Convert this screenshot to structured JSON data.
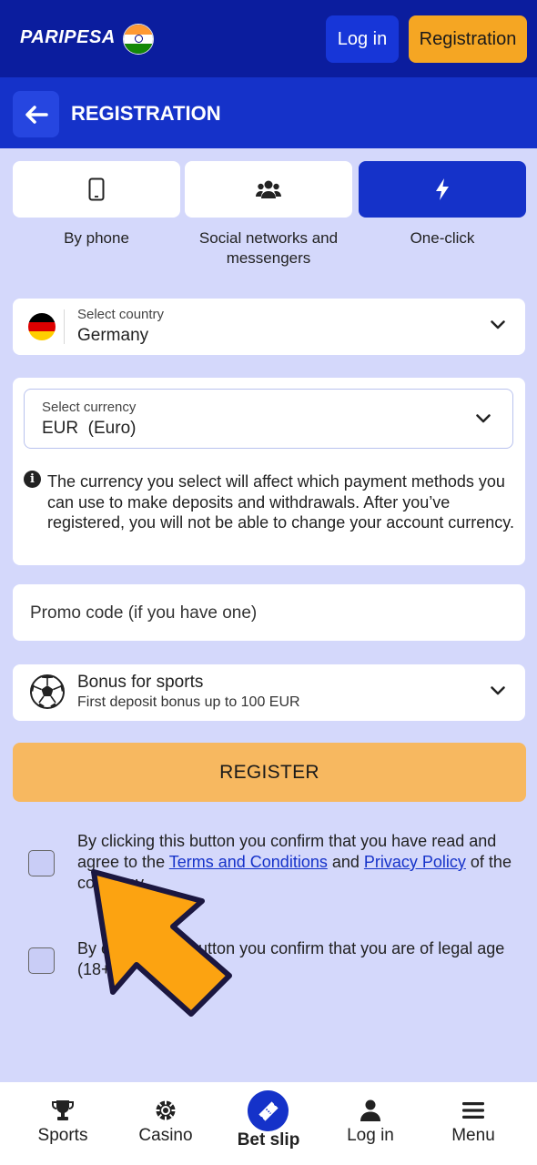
{
  "header": {
    "logo_text": "PARIPESA",
    "login_label": "Log in",
    "registration_label": "Registration"
  },
  "registration": {
    "title": "REGISTRATION",
    "tabs": [
      {
        "label": "By phone",
        "icon": "phone-icon",
        "active": false
      },
      {
        "label": "Social networks and messengers",
        "icon": "users-icon",
        "active": false
      },
      {
        "label": "One-click",
        "icon": "lightning-icon",
        "active": true
      }
    ],
    "country": {
      "label": "Select country",
      "value": "Germany"
    },
    "currency": {
      "label": "Select currency",
      "value": "EUR  (Euro)"
    },
    "currency_info": "The currency you select will affect which payment methods you can use to make deposits and withdrawals. After you’ve registered, you will not be able to change your account currency.",
    "promo": {
      "placeholder": "Promo code (if you have one)"
    },
    "bonus": {
      "title": "Bonus for sports",
      "subtitle": "First deposit bonus up to 100 EUR"
    },
    "register_label": "REGISTER",
    "consent_terms": {
      "prefix": "By clicking this button you confirm that you have read and agree to the ",
      "terms_link": "Terms and Conditions",
      "middle": " and ",
      "privacy_link": "Privacy Policy",
      "suffix": " of the company."
    },
    "consent_age": "By clicking this button you confirm that you are of legal age (18+)."
  },
  "bottom_nav": [
    {
      "label": "Sports",
      "icon": "trophy-icon"
    },
    {
      "label": "Casino",
      "icon": "casino-chip-icon"
    },
    {
      "label": "Bet slip",
      "icon": "ticket-icon"
    },
    {
      "label": "Log in",
      "icon": "user-icon"
    },
    {
      "label": "Menu",
      "icon": "menu-icon"
    }
  ],
  "colors": {
    "header_bg": "#0b1d9e",
    "primary": "#1532c9",
    "accent": "#f5a623",
    "page_bg": "#d4d8fb"
  }
}
